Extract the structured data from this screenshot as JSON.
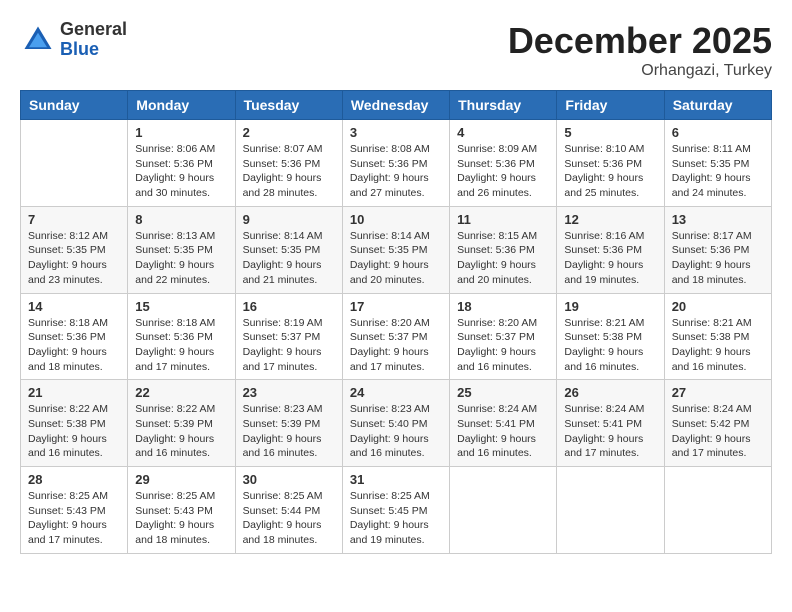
{
  "header": {
    "logo": {
      "general": "General",
      "blue": "Blue"
    },
    "title": "December 2025",
    "location": "Orhangazi, Turkey"
  },
  "weekdays": [
    "Sunday",
    "Monday",
    "Tuesday",
    "Wednesday",
    "Thursday",
    "Friday",
    "Saturday"
  ],
  "weeks": [
    [
      {
        "day": null,
        "sunrise": null,
        "sunset": null,
        "daylight": null
      },
      {
        "day": "1",
        "sunrise": "Sunrise: 8:06 AM",
        "sunset": "Sunset: 5:36 PM",
        "daylight": "Daylight: 9 hours and 30 minutes."
      },
      {
        "day": "2",
        "sunrise": "Sunrise: 8:07 AM",
        "sunset": "Sunset: 5:36 PM",
        "daylight": "Daylight: 9 hours and 28 minutes."
      },
      {
        "day": "3",
        "sunrise": "Sunrise: 8:08 AM",
        "sunset": "Sunset: 5:36 PM",
        "daylight": "Daylight: 9 hours and 27 minutes."
      },
      {
        "day": "4",
        "sunrise": "Sunrise: 8:09 AM",
        "sunset": "Sunset: 5:36 PM",
        "daylight": "Daylight: 9 hours and 26 minutes."
      },
      {
        "day": "5",
        "sunrise": "Sunrise: 8:10 AM",
        "sunset": "Sunset: 5:36 PM",
        "daylight": "Daylight: 9 hours and 25 minutes."
      },
      {
        "day": "6",
        "sunrise": "Sunrise: 8:11 AM",
        "sunset": "Sunset: 5:35 PM",
        "daylight": "Daylight: 9 hours and 24 minutes."
      }
    ],
    [
      {
        "day": "7",
        "sunrise": "Sunrise: 8:12 AM",
        "sunset": "Sunset: 5:35 PM",
        "daylight": "Daylight: 9 hours and 23 minutes."
      },
      {
        "day": "8",
        "sunrise": "Sunrise: 8:13 AM",
        "sunset": "Sunset: 5:35 PM",
        "daylight": "Daylight: 9 hours and 22 minutes."
      },
      {
        "day": "9",
        "sunrise": "Sunrise: 8:14 AM",
        "sunset": "Sunset: 5:35 PM",
        "daylight": "Daylight: 9 hours and 21 minutes."
      },
      {
        "day": "10",
        "sunrise": "Sunrise: 8:14 AM",
        "sunset": "Sunset: 5:35 PM",
        "daylight": "Daylight: 9 hours and 20 minutes."
      },
      {
        "day": "11",
        "sunrise": "Sunrise: 8:15 AM",
        "sunset": "Sunset: 5:36 PM",
        "daylight": "Daylight: 9 hours and 20 minutes."
      },
      {
        "day": "12",
        "sunrise": "Sunrise: 8:16 AM",
        "sunset": "Sunset: 5:36 PM",
        "daylight": "Daylight: 9 hours and 19 minutes."
      },
      {
        "day": "13",
        "sunrise": "Sunrise: 8:17 AM",
        "sunset": "Sunset: 5:36 PM",
        "daylight": "Daylight: 9 hours and 18 minutes."
      }
    ],
    [
      {
        "day": "14",
        "sunrise": "Sunrise: 8:18 AM",
        "sunset": "Sunset: 5:36 PM",
        "daylight": "Daylight: 9 hours and 18 minutes."
      },
      {
        "day": "15",
        "sunrise": "Sunrise: 8:18 AM",
        "sunset": "Sunset: 5:36 PM",
        "daylight": "Daylight: 9 hours and 17 minutes."
      },
      {
        "day": "16",
        "sunrise": "Sunrise: 8:19 AM",
        "sunset": "Sunset: 5:37 PM",
        "daylight": "Daylight: 9 hours and 17 minutes."
      },
      {
        "day": "17",
        "sunrise": "Sunrise: 8:20 AM",
        "sunset": "Sunset: 5:37 PM",
        "daylight": "Daylight: 9 hours and 17 minutes."
      },
      {
        "day": "18",
        "sunrise": "Sunrise: 8:20 AM",
        "sunset": "Sunset: 5:37 PM",
        "daylight": "Daylight: 9 hours and 16 minutes."
      },
      {
        "day": "19",
        "sunrise": "Sunrise: 8:21 AM",
        "sunset": "Sunset: 5:38 PM",
        "daylight": "Daylight: 9 hours and 16 minutes."
      },
      {
        "day": "20",
        "sunrise": "Sunrise: 8:21 AM",
        "sunset": "Sunset: 5:38 PM",
        "daylight": "Daylight: 9 hours and 16 minutes."
      }
    ],
    [
      {
        "day": "21",
        "sunrise": "Sunrise: 8:22 AM",
        "sunset": "Sunset: 5:38 PM",
        "daylight": "Daylight: 9 hours and 16 minutes."
      },
      {
        "day": "22",
        "sunrise": "Sunrise: 8:22 AM",
        "sunset": "Sunset: 5:39 PM",
        "daylight": "Daylight: 9 hours and 16 minutes."
      },
      {
        "day": "23",
        "sunrise": "Sunrise: 8:23 AM",
        "sunset": "Sunset: 5:39 PM",
        "daylight": "Daylight: 9 hours and 16 minutes."
      },
      {
        "day": "24",
        "sunrise": "Sunrise: 8:23 AM",
        "sunset": "Sunset: 5:40 PM",
        "daylight": "Daylight: 9 hours and 16 minutes."
      },
      {
        "day": "25",
        "sunrise": "Sunrise: 8:24 AM",
        "sunset": "Sunset: 5:41 PM",
        "daylight": "Daylight: 9 hours and 16 minutes."
      },
      {
        "day": "26",
        "sunrise": "Sunrise: 8:24 AM",
        "sunset": "Sunset: 5:41 PM",
        "daylight": "Daylight: 9 hours and 17 minutes."
      },
      {
        "day": "27",
        "sunrise": "Sunrise: 8:24 AM",
        "sunset": "Sunset: 5:42 PM",
        "daylight": "Daylight: 9 hours and 17 minutes."
      }
    ],
    [
      {
        "day": "28",
        "sunrise": "Sunrise: 8:25 AM",
        "sunset": "Sunset: 5:43 PM",
        "daylight": "Daylight: 9 hours and 17 minutes."
      },
      {
        "day": "29",
        "sunrise": "Sunrise: 8:25 AM",
        "sunset": "Sunset: 5:43 PM",
        "daylight": "Daylight: 9 hours and 18 minutes."
      },
      {
        "day": "30",
        "sunrise": "Sunrise: 8:25 AM",
        "sunset": "Sunset: 5:44 PM",
        "daylight": "Daylight: 9 hours and 18 minutes."
      },
      {
        "day": "31",
        "sunrise": "Sunrise: 8:25 AM",
        "sunset": "Sunset: 5:45 PM",
        "daylight": "Daylight: 9 hours and 19 minutes."
      },
      {
        "day": null,
        "sunrise": null,
        "sunset": null,
        "daylight": null
      },
      {
        "day": null,
        "sunrise": null,
        "sunset": null,
        "daylight": null
      },
      {
        "day": null,
        "sunrise": null,
        "sunset": null,
        "daylight": null
      }
    ]
  ]
}
